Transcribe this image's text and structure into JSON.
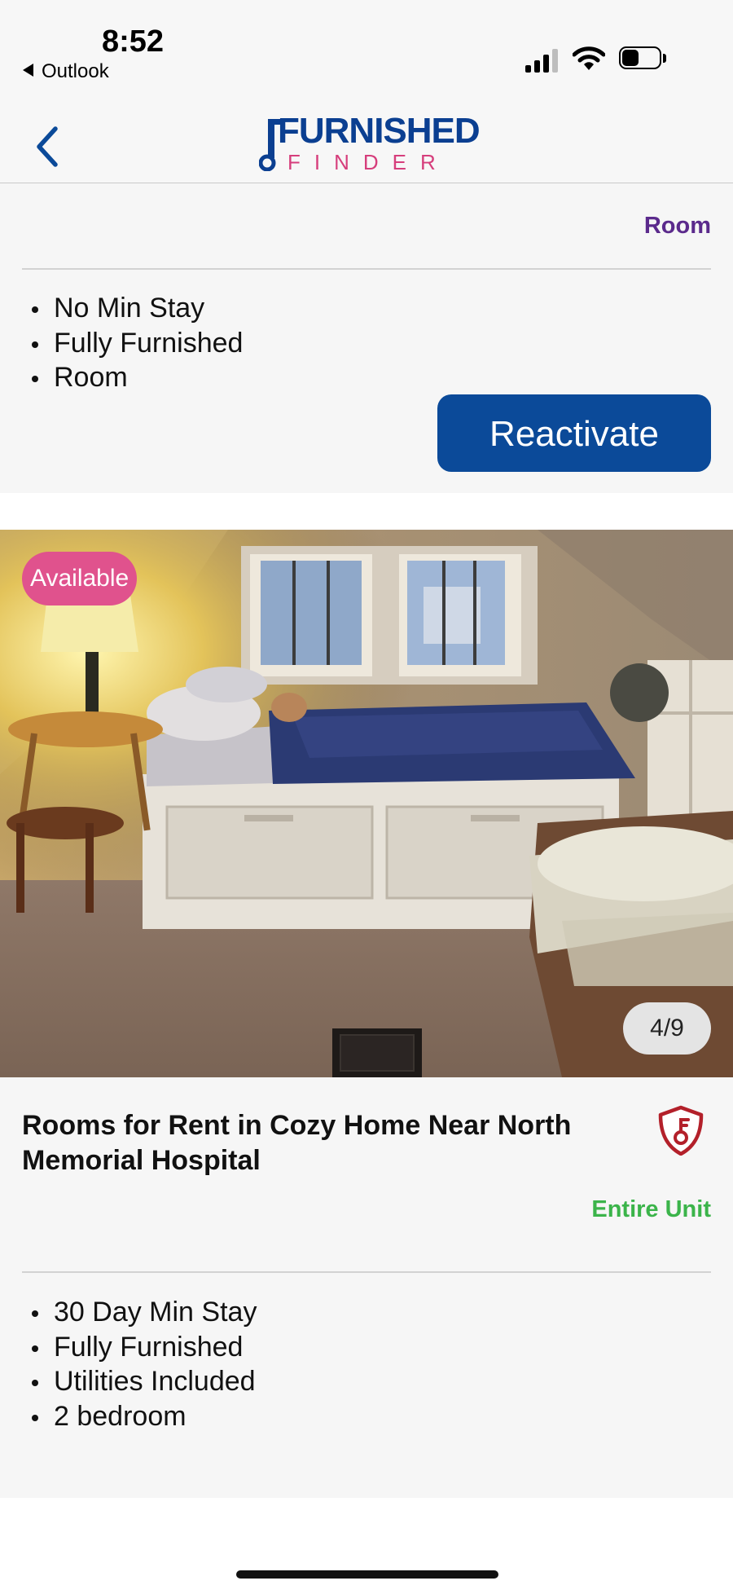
{
  "status_bar": {
    "time": "8:52",
    "back_app": "Outlook",
    "battery_level": 0.45
  },
  "header": {
    "logo_line1": "FURNISHED",
    "logo_line2": "FINDER",
    "logo_color_primary": "#0b3f91",
    "logo_color_accent": "#d63e7c"
  },
  "listings": [
    {
      "type": "Room",
      "type_color": "#5b2a8c",
      "features": [
        "No Min Stay",
        "Fully Furnished",
        "Room"
      ],
      "action_button": "Reactivate"
    },
    {
      "availability_badge": "Available",
      "photo_counter": "4/9",
      "title": "Rooms for Rent in Cozy  Home Near North Memorial Hospital",
      "type": "Entire Unit",
      "type_color": "#3bb44a",
      "features": [
        "30 Day Min Stay",
        "Fully Furnished",
        "Utilities Included",
        "2 bedroom"
      ]
    }
  ],
  "colors": {
    "button_primary": "#0b4a99",
    "badge_available": "#e0528d",
    "shield": "#b3202a"
  },
  "icons": [
    "back-chevron-icon",
    "signal-icon",
    "wifi-icon",
    "battery-icon",
    "verified-shield-icon"
  ]
}
